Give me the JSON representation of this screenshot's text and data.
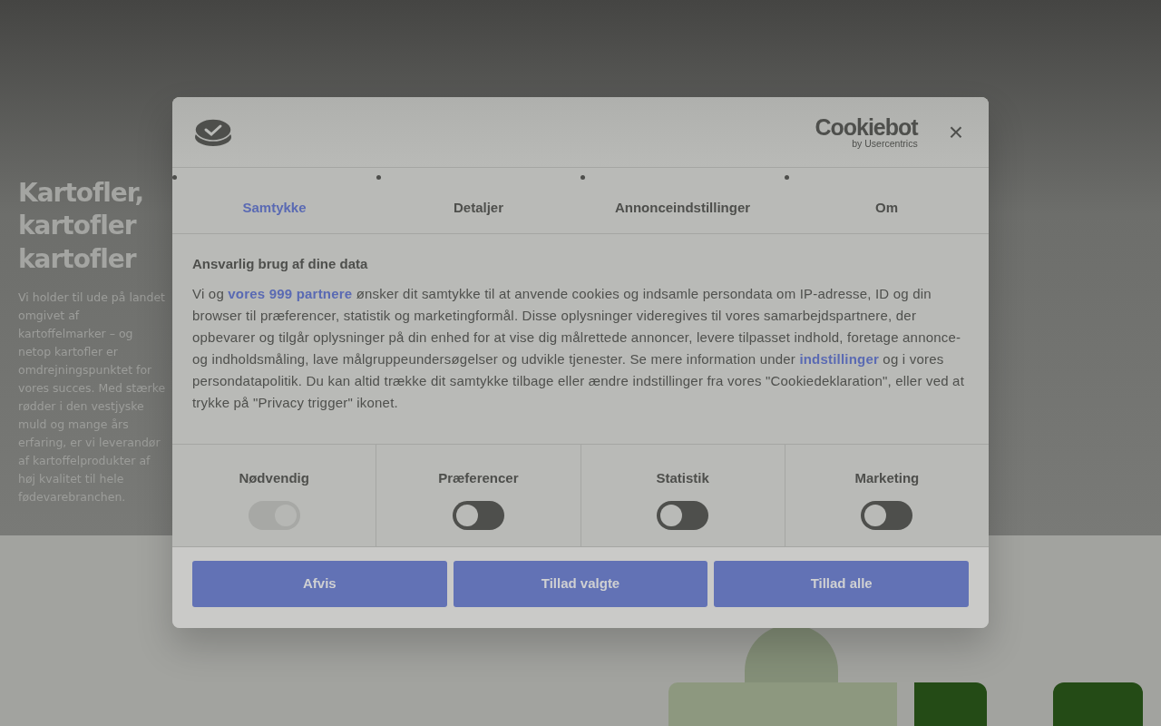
{
  "hero": {
    "title": "Kartofler, kartofler kartofler",
    "text": "Vi holder til ude på landet omgivet af kartoffelmarker – og netop kartofler er omdrejningspunktet for vores succes. Med stærke rødder i den vestjyske muld og mange års erfaring, er vi leverandør af kartoffelprodukter af høj kvalitet til hele fødevarebranchen."
  },
  "dialog": {
    "brand": {
      "name": "Cookiebot",
      "byline": "by Usercentrics"
    },
    "close": "×",
    "tabs": [
      {
        "label": "Samtykke",
        "selected": true
      },
      {
        "label": "Detaljer",
        "selected": false
      },
      {
        "label": "Annonceindstillinger",
        "selected": false
      },
      {
        "label": "Om",
        "selected": false
      }
    ],
    "heading": "Ansvarlig brug af dine data",
    "body": [
      {
        "kind": "text",
        "text": "Vi og "
      },
      {
        "kind": "link",
        "text": "vores 999 partnere"
      },
      {
        "kind": "text",
        "text": " ønsker dit samtykke til at anvende cookies og indsamle persondata om IP-adresse, ID og din browser til præferencer, statistik og marketingformål. Disse oplysninger videregives til vores samarbejdspartnere, der opbevarer og tilgår oplysninger på din enhed for at vise dig målrettede annoncer, levere tilpasset indhold, foretage annonce- og indholdsmåling, lave målgruppeundersøgelser og udvikle tjenester. Se mere information under "
      },
      {
        "kind": "link",
        "text": "indstillinger"
      },
      {
        "kind": "text",
        "text": " og i vores persondatapolitik. Du kan altid trække dit samtykke tilbage eller ændre indstillinger fra vores \"Cookiedeklaration\", eller ved at trykke på \"Privacy trigger\" ikonet."
      }
    ],
    "categories": [
      {
        "label": "Nødvendig",
        "on": true,
        "disabled": true
      },
      {
        "label": "Præferencer",
        "on": false,
        "disabled": false
      },
      {
        "label": "Statistik",
        "on": false,
        "disabled": false
      },
      {
        "label": "Marketing",
        "on": false,
        "disabled": false
      }
    ],
    "buttons": [
      "Afvis",
      "Tillad valgte",
      "Tillad alle"
    ]
  }
}
